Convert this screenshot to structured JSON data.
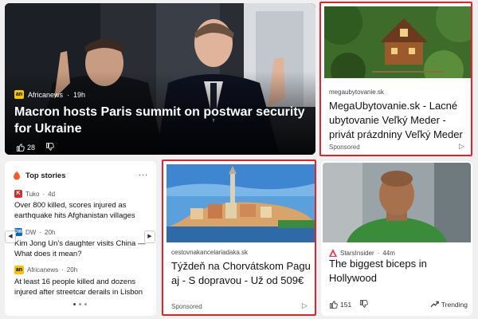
{
  "hero": {
    "source": "Africanews",
    "source_logo": "an",
    "age": "19h",
    "title": "Macron hosts Paris summit on postwar security for Ukraine",
    "likes": "28"
  },
  "ad1": {
    "domain": "megaubytovanie.sk",
    "headline": "MegaUbytovanie.sk - Lacné ubytovanie Veľký Meder - privát prázdniny Veľký Meder",
    "sponsored": "Sponsored"
  },
  "top_stories": {
    "header": "Top stories",
    "more": "...",
    "items": [
      {
        "source": "Tuko",
        "source_logo": "K",
        "age": "4d",
        "text": "Over 800 killed, scores injured as earthquake hits Afghanistan villages"
      },
      {
        "source": "DW",
        "source_logo": "DW",
        "age": "20h",
        "text": "Kim Jong Un's daughter visits China — What does it mean?"
      },
      {
        "source": "Africanews",
        "source_logo": "an",
        "age": "20h",
        "text": "At least 16 people killed and dozens injured after streetcar derails in Lisbon"
      }
    ],
    "prev": "◀",
    "next": "▶"
  },
  "ad2": {
    "domain": "cestovnakancelariadaka.sk",
    "headline": "Týždeň na Chorvátskom Pagu aj - S dopravou - Už od 509€",
    "sponsored": "Sponsored"
  },
  "celeb": {
    "source": "StarsInsider",
    "age": "44m",
    "title": "The biggest biceps in Hollywood",
    "likes": "151",
    "trending": "Trending"
  },
  "colors": {
    "ad_border": "#e0242e",
    "background": "#f0f0f0"
  }
}
